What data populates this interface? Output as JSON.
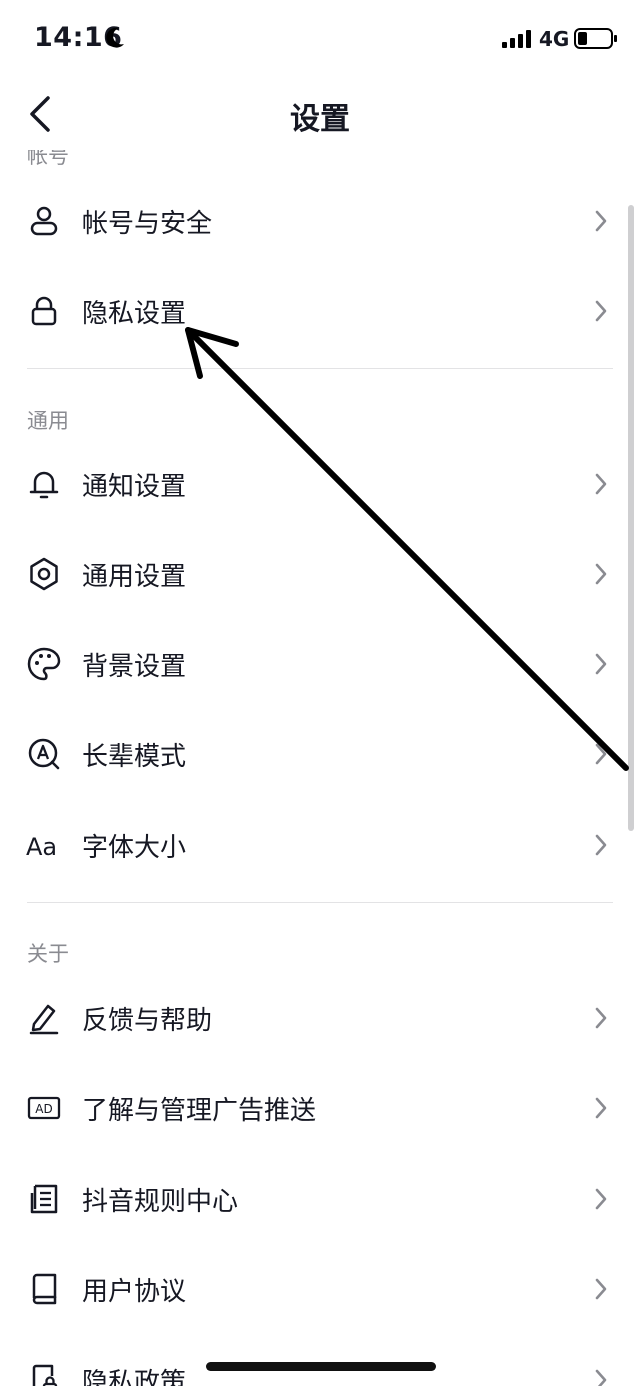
{
  "status": {
    "time": "14:16",
    "network": "4G"
  },
  "nav": {
    "title": "设置"
  },
  "sections": {
    "account": "帐号",
    "general": "通用",
    "about": "关于"
  },
  "items": {
    "account_security": "帐号与安全",
    "privacy_settings": "隐私设置",
    "notification_settings": "通知设置",
    "general_settings": "通用设置",
    "background_settings": "背景设置",
    "elder_mode": "长辈模式",
    "font_size": "字体大小",
    "font_size_icon_text": "Aa",
    "feedback_help": "反馈与帮助",
    "ad_management": "了解与管理广告推送",
    "ad_icon_text": "AD",
    "community_rules": "抖音规则中心",
    "user_agreement": "用户协议",
    "privacy_policy": "隐私政策"
  }
}
